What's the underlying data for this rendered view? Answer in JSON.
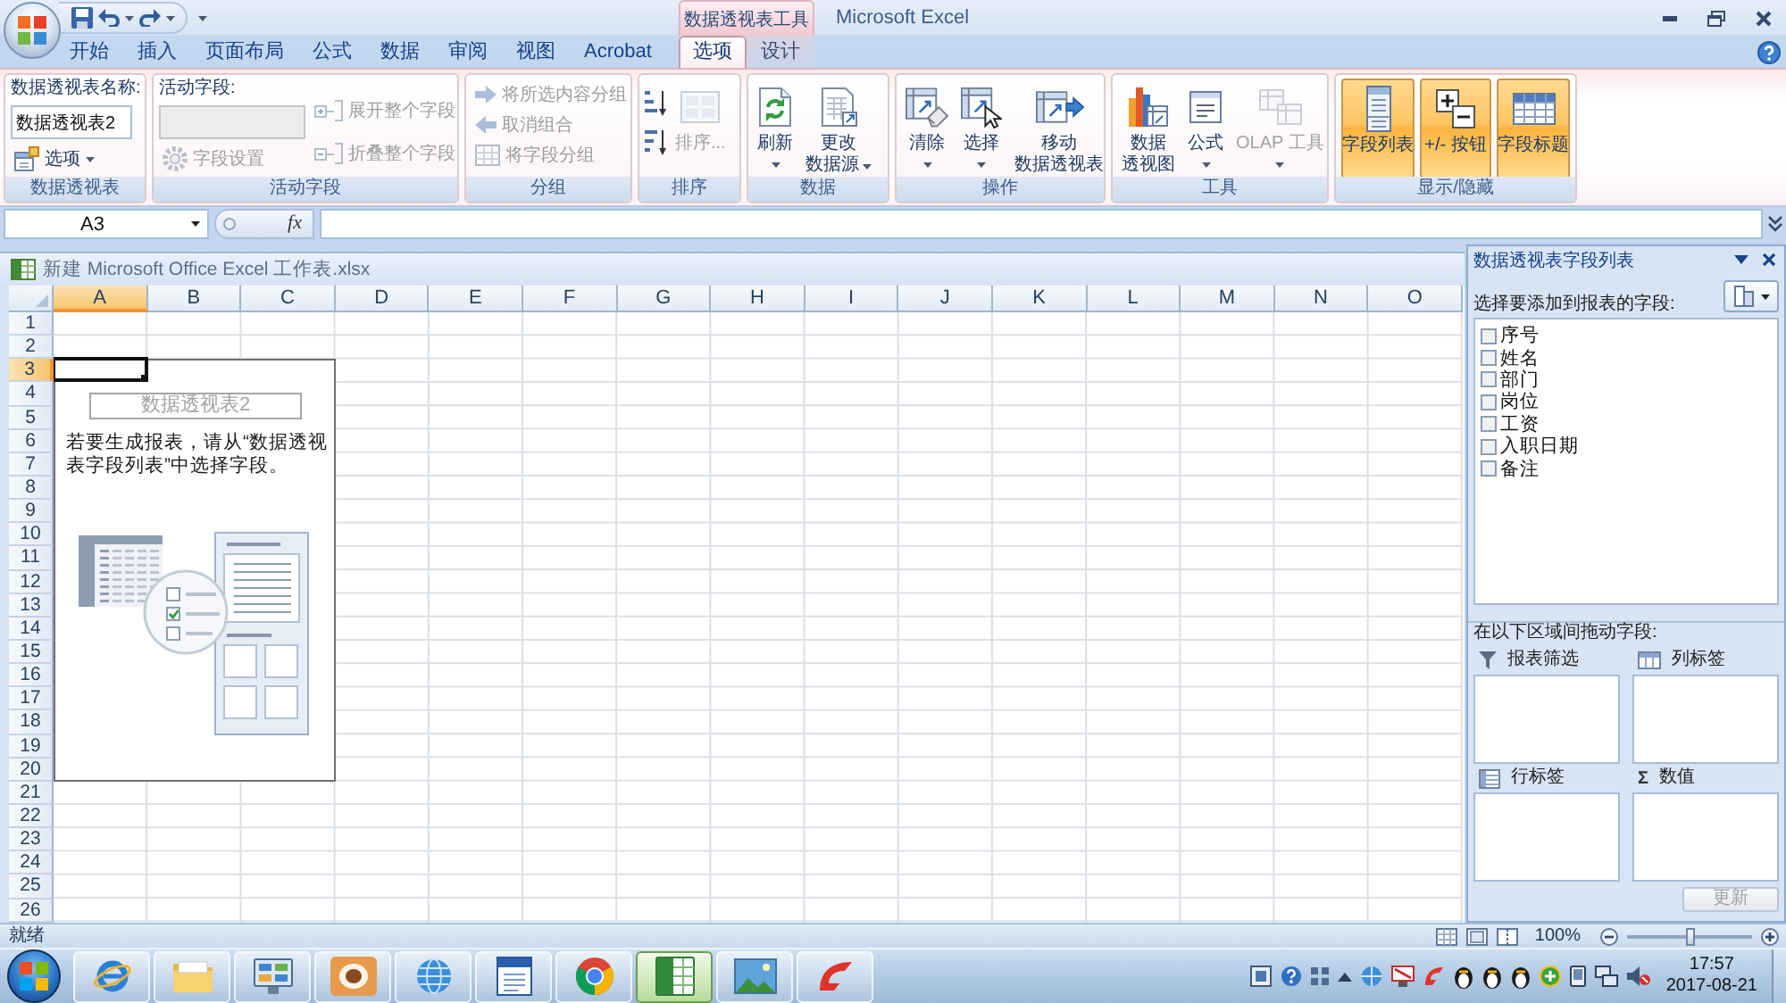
{
  "window": {
    "title": "Microsoft Excel",
    "tool_group": "数据透视表工具"
  },
  "tabs": [
    {
      "label": "开始",
      "kind": "standard",
      "selected": false
    },
    {
      "label": "插入",
      "kind": "standard",
      "selected": false
    },
    {
      "label": "页面布局",
      "kind": "standard",
      "selected": false
    },
    {
      "label": "公式",
      "kind": "standard",
      "selected": false
    },
    {
      "label": "数据",
      "kind": "standard",
      "selected": false
    },
    {
      "label": "审阅",
      "kind": "standard",
      "selected": false
    },
    {
      "label": "视图",
      "kind": "standard",
      "selected": false
    },
    {
      "label": "Acrobat",
      "kind": "standard",
      "selected": false
    },
    {
      "label": "选项",
      "kind": "contextual",
      "selected": true
    },
    {
      "label": "设计",
      "kind": "contextual",
      "selected": false
    }
  ],
  "ribbon": [
    {
      "label": "数据透视表",
      "kind": "name",
      "field_label": "数据透视表名称:",
      "field": {
        "value": "数据透视表2",
        "disabled": false
      },
      "buttons": [
        {
          "label": "选项",
          "dropdown": true,
          "disabled": false
        }
      ]
    },
    {
      "label": "活动字段",
      "kind": "field",
      "field_label": "活动字段:",
      "field": {
        "disabled": true
      },
      "buttons": [
        {
          "label": "字段设置",
          "dropdown": false,
          "disabled": true
        },
        {
          "label": "展开整个字段",
          "dropdown": false,
          "disabled": true
        },
        {
          "label": "折叠整个字段",
          "dropdown": false,
          "disabled": true
        }
      ]
    },
    {
      "label": "分组",
      "kind": "list",
      "buttons": [
        {
          "label": "将所选内容分组",
          "dropdown": false,
          "disabled": true
        },
        {
          "label": "取消组合",
          "dropdown": false,
          "disabled": true
        },
        {
          "label": "将字段分组",
          "dropdown": false,
          "disabled": true
        }
      ]
    },
    {
      "label": "排序",
      "kind": "sort",
      "buttons": [
        {
          "lines": [
            "排序..."
          ],
          "dropdown": false,
          "disabled": true
        }
      ]
    },
    {
      "label": "数据",
      "kind": "large",
      "buttons": [
        {
          "lines": [
            "刷新"
          ],
          "dropdown": true,
          "disabled": false
        },
        {
          "lines": [
            "更改",
            "数据源"
          ],
          "dropdown": true,
          "disabled": false
        }
      ]
    },
    {
      "label": "操作",
      "kind": "large",
      "buttons": [
        {
          "lines": [
            "清除"
          ],
          "dropdown": true,
          "disabled": false
        },
        {
          "lines": [
            "选择"
          ],
          "dropdown": true,
          "disabled": false
        },
        {
          "lines": [
            "移动",
            "数据透视表"
          ],
          "dropdown": false,
          "disabled": false
        }
      ]
    },
    {
      "label": "工具",
      "kind": "large",
      "buttons": [
        {
          "lines": [
            "数据",
            "透视图"
          ],
          "dropdown": false,
          "disabled": false
        },
        {
          "lines": [
            "公式"
          ],
          "dropdown": true,
          "disabled": false
        },
        {
          "lines": [
            "OLAP 工具"
          ],
          "dropdown": true,
          "disabled": true
        }
      ]
    },
    {
      "label": "显示/隐藏",
      "kind": "toggle",
      "buttons": [
        {
          "lines": [
            "字段列表"
          ],
          "on": true
        },
        {
          "lines": [
            "+/- 按钮"
          ],
          "on": true
        },
        {
          "lines": [
            "字段标题"
          ],
          "on": true
        }
      ]
    }
  ],
  "formula_bar": {
    "name_box": "A3",
    "function_button": "fx"
  },
  "workbook": {
    "title": "新建 Microsoft Office Excel 工作表.xlsx",
    "columns": [
      {
        "label": "A",
        "selected": true
      },
      {
        "label": "B",
        "selected": false
      },
      {
        "label": "C",
        "selected": false
      },
      {
        "label": "D",
        "selected": false
      },
      {
        "label": "E",
        "selected": false
      },
      {
        "label": "F",
        "selected": false
      },
      {
        "label": "G",
        "selected": false
      },
      {
        "label": "H",
        "selected": false
      },
      {
        "label": "I",
        "selected": false
      },
      {
        "label": "J",
        "selected": false
      },
      {
        "label": "K",
        "selected": false
      },
      {
        "label": "L",
        "selected": false
      },
      {
        "label": "M",
        "selected": false
      },
      {
        "label": "N",
        "selected": false
      },
      {
        "label": "O",
        "selected": false
      }
    ],
    "rows": [
      {
        "label": "1",
        "selected": false
      },
      {
        "label": "2",
        "selected": false
      },
      {
        "label": "3",
        "selected": true
      },
      {
        "label": "4",
        "selected": false
      },
      {
        "label": "5",
        "selected": false
      },
      {
        "label": "6",
        "selected": false
      },
      {
        "label": "7",
        "selected": false
      },
      {
        "label": "8",
        "selected": false
      },
      {
        "label": "9",
        "selected": false
      },
      {
        "label": "10",
        "selected": false
      },
      {
        "label": "11",
        "selected": false
      },
      {
        "label": "12",
        "selected": false
      },
      {
        "label": "13",
        "selected": false
      },
      {
        "label": "14",
        "selected": false
      },
      {
        "label": "15",
        "selected": false
      },
      {
        "label": "16",
        "selected": false
      },
      {
        "label": "17",
        "selected": false
      },
      {
        "label": "18",
        "selected": false
      },
      {
        "label": "19",
        "selected": false
      },
      {
        "label": "20",
        "selected": false
      },
      {
        "label": "21",
        "selected": false
      },
      {
        "label": "22",
        "selected": false
      },
      {
        "label": "23",
        "selected": false
      },
      {
        "label": "24",
        "selected": false
      },
      {
        "label": "25",
        "selected": false
      },
      {
        "label": "26",
        "selected": false
      }
    ],
    "pivot": {
      "title": "数据透视表2",
      "instruction": "若要生成报表，请从“数据透视表字段列表”中选择字段。"
    }
  },
  "field_list": {
    "title": "数据透视表字段列表",
    "choose_label": "选择要添加到报表的字段:",
    "fields": [
      {
        "label": "序号",
        "checked": false
      },
      {
        "label": "姓名",
        "checked": false
      },
      {
        "label": "部门",
        "checked": false
      },
      {
        "label": "岗位",
        "checked": false
      },
      {
        "label": "工资",
        "checked": false
      },
      {
        "label": "入职日期",
        "checked": false
      },
      {
        "label": "备注",
        "checked": false
      }
    ],
    "drag_label": "在以下区域间拖动字段:",
    "areas": [
      {
        "label": "报表筛选",
        "kind": "filter"
      },
      {
        "label": "列标签",
        "kind": "columns"
      },
      {
        "label": "行标签",
        "kind": "rows"
      },
      {
        "label": "数值",
        "kind": "values",
        "symbol": "Σ"
      }
    ],
    "update_button": {
      "label": "更新",
      "disabled": true
    }
  },
  "status_bar": {
    "text": "就绪",
    "zoom": "100%",
    "zoom_slider": {
      "level": 0.5
    }
  },
  "taskbar": {
    "apps": [
      {
        "selected": false
      },
      {
        "selected": false
      },
      {
        "selected": false
      },
      {
        "selected": false
      },
      {
        "selected": false
      },
      {
        "selected": false
      },
      {
        "selected": false
      },
      {
        "selected": true
      },
      {
        "selected": false
      },
      {
        "selected": false
      }
    ],
    "clock": {
      "time": "17:57",
      "date": "2017-08-21"
    }
  }
}
